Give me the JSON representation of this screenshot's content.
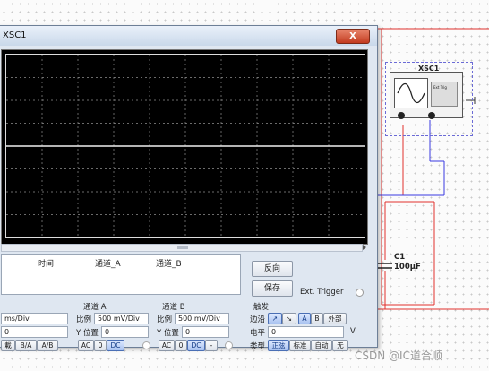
{
  "window": {
    "title": "XSC1",
    "close_label": "X"
  },
  "readout": {
    "col_time": "时间",
    "col_ch_a": "通道_A",
    "col_ch_b": "通道_B"
  },
  "buttons": {
    "reverse": "反向",
    "save": "保存"
  },
  "ext_trigger": "Ext. Trigger",
  "timebase": {
    "scale_value": "ms/Div",
    "position_value": "0",
    "modes": [
      "載",
      "B/A",
      "A/B"
    ]
  },
  "channel_a": {
    "header": "通道 A",
    "scale_label": "比例",
    "scale_value": "500 mV/Div",
    "position_label": "Y 位置",
    "position_value": "0",
    "coupling": [
      "AC",
      "0",
      "DC"
    ],
    "coupling_selected": "DC"
  },
  "channel_b": {
    "header": "通道 B",
    "scale_label": "比例",
    "scale_value": "500 mV/Div",
    "position_label": "Y 位置",
    "position_value": "0",
    "coupling": [
      "AC",
      "0",
      "DC",
      "-"
    ],
    "coupling_selected": "DC"
  },
  "trigger": {
    "header": "触发",
    "edge_label": "边沿",
    "edge_options": [
      "↗",
      "↘",
      "A",
      "B",
      "外部"
    ],
    "edge_selected": "A",
    "level_label": "电平",
    "level_value": "0",
    "level_unit": "V",
    "type_label": "类型",
    "type_options": [
      "正弦",
      "标准",
      "自动",
      "无"
    ],
    "type_selected": "正弦"
  },
  "schematic": {
    "component_label": "XSC1",
    "ext_trig_label": "Ext Trig",
    "capacitor_name": "C1",
    "capacitor_value": "100µF",
    "wire_colors": {
      "red": "#e0302c",
      "blue": "#3a3ae0"
    }
  },
  "watermark": "CSDN @IC道合顺"
}
